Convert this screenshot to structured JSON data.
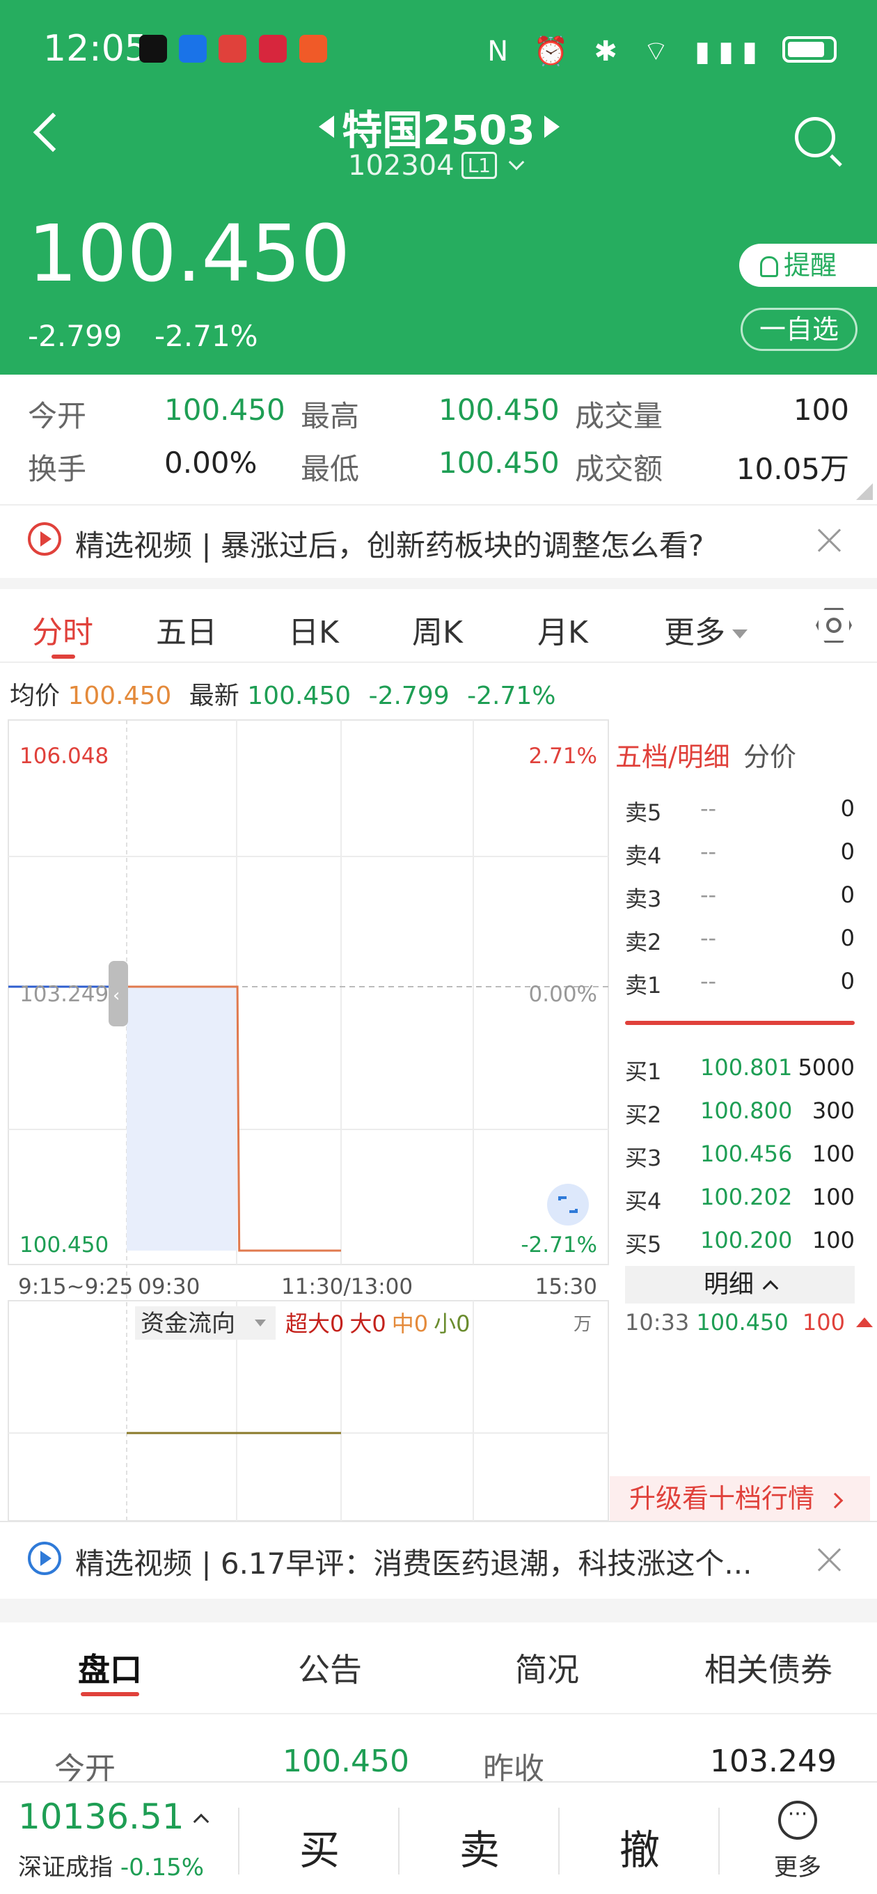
{
  "status": {
    "time": "12:05"
  },
  "header": {
    "title": "特国2503",
    "code": "102304",
    "level": "L1",
    "price": "100.450",
    "change": "-2.799",
    "change_pct": "-2.71%",
    "remind_label": "提醒",
    "watchlist_label": "一自选"
  },
  "stats": {
    "open_label": "今开",
    "open": "100.450",
    "high_label": "最高",
    "high": "100.450",
    "volume_label": "成交量",
    "volume": "100",
    "turnover_label": "换手",
    "turnover": "0.00%",
    "low_label": "最低",
    "low": "100.450",
    "amount_label": "成交额",
    "amount": "10.05万"
  },
  "banner1": "精选视频 | 暴涨过后，创新药板块的调整怎么看?",
  "tabs": [
    "分时",
    "五日",
    "日K",
    "周K",
    "月K",
    "更多"
  ],
  "avg_line": {
    "avg_label": "均价",
    "avg": "100.450",
    "latest_label": "最新",
    "latest": "100.450",
    "change": "-2.799",
    "change_pct": "-2.71%"
  },
  "chart": {
    "y_top": "106.048",
    "y_mid": "103.249",
    "y_bottom": "100.450",
    "pct_top": "2.71%",
    "pct_mid": "0.00%",
    "pct_bottom": "-2.71%",
    "x_labels": [
      "9:15~9:25",
      "09:30",
      "11:30/13:00",
      "15:30"
    ],
    "flow_title": "资金流向",
    "flow_xl_label": "超大",
    "flow_xl": "0",
    "flow_l_label": "大",
    "flow_l": "0",
    "flow_m_label": "中",
    "flow_m": "0",
    "flow_s_label": "小",
    "flow_s": "0",
    "flow_unit": "万"
  },
  "chart_data": {
    "type": "line",
    "title": "",
    "series": [
      {
        "name": "",
        "x": [
          "09:30",
          "10:32",
          "10:33",
          "11:30"
        ],
        "values": [
          103.249,
          103.249,
          100.45,
          100.45
        ]
      }
    ],
    "ylim": [
      100.45,
      106.048
    ],
    "prev_close": 103.249,
    "xlabel": "",
    "ylabel": ""
  },
  "orderbook": {
    "title": "五档/明细",
    "tab2": "分价",
    "asks": [
      {
        "name": "卖5",
        "price": "--",
        "vol": "0"
      },
      {
        "name": "卖4",
        "price": "--",
        "vol": "0"
      },
      {
        "name": "卖3",
        "price": "--",
        "vol": "0"
      },
      {
        "name": "卖2",
        "price": "--",
        "vol": "0"
      },
      {
        "name": "卖1",
        "price": "--",
        "vol": "0"
      }
    ],
    "bids": [
      {
        "name": "买1",
        "price": "100.801",
        "vol": "5000"
      },
      {
        "name": "买2",
        "price": "100.800",
        "vol": "300"
      },
      {
        "name": "买3",
        "price": "100.456",
        "vol": "100"
      },
      {
        "name": "买4",
        "price": "100.202",
        "vol": "100"
      },
      {
        "name": "买5",
        "price": "100.200",
        "vol": "100"
      }
    ],
    "detail_label": "明细",
    "tick": {
      "time": "10:33",
      "price": "100.450",
      "vol": "100"
    },
    "upgrade_label": "升级看十档行情"
  },
  "banner2": "精选视频 | 6.17早评：消费医药退潮，科技涨这个...",
  "bottom_tabs": [
    "盘口",
    "公告",
    "简况",
    "相关债券"
  ],
  "panel": {
    "open_label": "今开",
    "open": "100.450",
    "prev_label": "昨收",
    "prev": "103.249"
  },
  "footer": {
    "index_value": "10136.51",
    "index_name": "深证成指",
    "index_change": "-0.15%",
    "buy": "买",
    "sell": "卖",
    "cancel": "撤",
    "more": "更多"
  },
  "colors": {
    "brand_green": "#26ad5f",
    "up_red": "#e0413b",
    "down_green": "#1e9e54",
    "price_line": "#e07a4f",
    "avg_line": "#2f5fcf"
  }
}
